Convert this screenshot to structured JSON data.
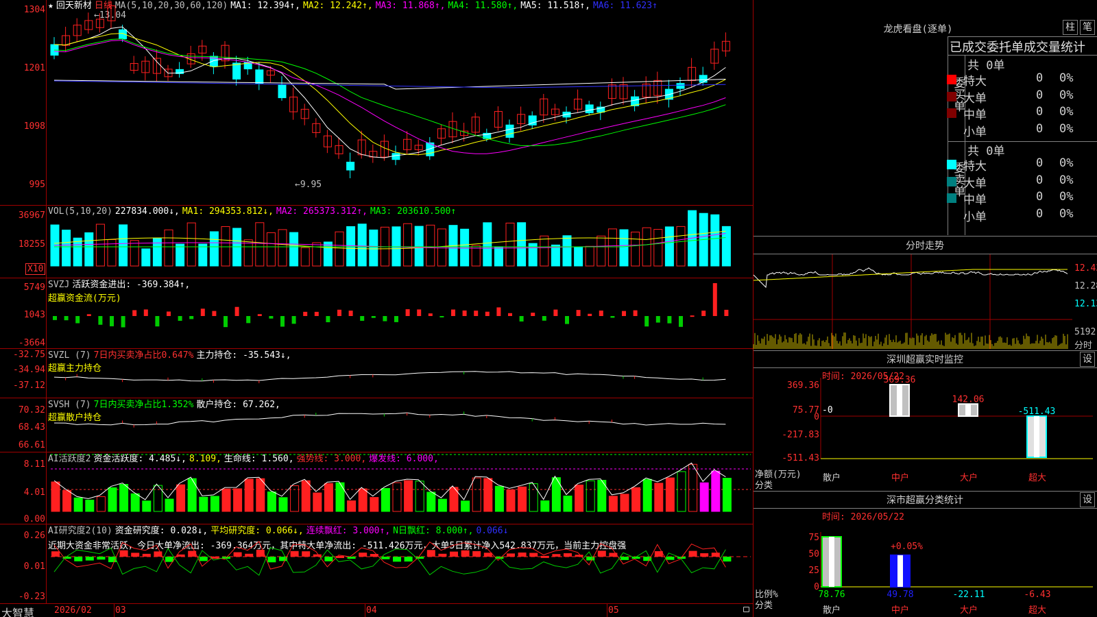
{
  "colors": {
    "up": "#ff2020",
    "down": "#00ffff",
    "ma1": "#ffffff",
    "ma2": "#ffff00",
    "ma3": "#ff00ff",
    "ma4": "#00ff00",
    "ma5": "#ffffff",
    "ma6": "#3030ff",
    "grid": "#a00000"
  },
  "kpanel": {
    "star": "★",
    "stock": "回天新材",
    "period": "日线",
    "items": [
      {
        "t": "MA(5,10,20,30,60,120)",
        "c": "#c0c0c0"
      },
      {
        "t": "MA1: 12.394↑,",
        "c": "#ffffff"
      },
      {
        "t": "MA2: 12.242↑,",
        "c": "#ffff00"
      },
      {
        "t": "MA3: 11.868↑,",
        "c": "#ff00ff"
      },
      {
        "t": "MA4: 11.580↑,",
        "c": "#00ff00"
      },
      {
        "t": "MA5: 11.518↑,",
        "c": "#ffffff"
      },
      {
        "t": "MA6: 11.623↑",
        "c": "#3030ff"
      }
    ],
    "ticks": [
      "1304",
      "1201",
      "1098",
      "995"
    ],
    "high_label": "←13.04",
    "low_label": "←9.95"
  },
  "vol": {
    "items": [
      {
        "t": "VOL(5,10,20)",
        "c": "#c0c0c0"
      },
      {
        "t": "227834.000↓,",
        "c": "#ffffff"
      },
      {
        "t": "MA1: 294353.812↓,",
        "c": "#ffff00"
      },
      {
        "t": "MA2: 265373.312↑,",
        "c": "#ff00ff"
      },
      {
        "t": "MA3: 203610.500↑",
        "c": "#00ff00"
      }
    ],
    "ticks": [
      "36967",
      "18255"
    ],
    "unit": "X10"
  },
  "svzj": {
    "items": [
      {
        "t": "SVZJ",
        "c": "#c0c0c0"
      },
      {
        "t": "活跃资金进出: -369.384↑,",
        "c": "#ffffff"
      }
    ],
    "subtitle": "超赢资金流(万元)",
    "ticks": [
      "5749",
      "1043",
      "-3664"
    ]
  },
  "svzl": {
    "items": [
      {
        "t": "SVZL (7)",
        "c": "#c0c0c0"
      },
      {
        "t": "7日内买卖净占比0.647%",
        "c": "#ff3030"
      },
      {
        "t": "主力持仓: -35.543↓,",
        "c": "#ffffff"
      }
    ],
    "subtitle": "超赢主力持仓",
    "ticks": [
      "-32.75",
      "-34.94",
      "-37.12"
    ]
  },
  "svsh": {
    "items": [
      {
        "t": "SVSH (7)",
        "c": "#c0c0c0"
      },
      {
        "t": "7日内买卖净占比1.352%",
        "c": "#00ff00"
      },
      {
        "t": "散户持仓: 67.262,",
        "c": "#ffffff"
      }
    ],
    "subtitle": "超赢散户持仓",
    "ticks": [
      "70.32",
      "68.43",
      "66.61"
    ]
  },
  "ai1": {
    "items": [
      {
        "t": "AI活跃度2",
        "c": "#c0c0c0"
      },
      {
        "t": "资金活跃度: 4.485↓,",
        "c": "#ffffff"
      },
      {
        "t": "8.109,",
        "c": "#ffff00"
      },
      {
        "t": "生命线: 1.560,",
        "c": "#ffffff"
      },
      {
        "t": "强势线: 3.000,",
        "c": "#ff3030"
      },
      {
        "t": "爆发线: 6.000,",
        "c": "#ff00ff"
      }
    ],
    "ticks": [
      "8.11",
      "4.01",
      "0.00"
    ]
  },
  "ai2": {
    "items": [
      {
        "t": "AI研究度2(10)",
        "c": "#c0c0c0"
      },
      {
        "t": "资金研究度: 0.028↓,",
        "c": "#ffffff"
      },
      {
        "t": "平均研究度: 0.066↓,",
        "c": "#ffff00"
      },
      {
        "t": "连续飘红: 3.000↑,",
        "c": "#ff00ff"
      },
      {
        "t": "N日飘红: 8.000↑,",
        "c": "#00ff00"
      },
      {
        "t": "0.066↓",
        "c": "#3030ff"
      }
    ],
    "comment": "近期大资金非常活跃，今日大单净流出: -369.364万元，其中特大单净流出: -511.426万元，大单5日累计净入542.837万元，当前主力控盘强",
    "ticks": [
      "0.26",
      "0.01",
      "-0.23"
    ]
  },
  "timeline": {
    "brand": "大智慧",
    "labels": [
      "2026/02",
      "03",
      "04",
      "05"
    ]
  },
  "lhb": {
    "title": "龙虎看盘(逐单)",
    "btn1": "柱",
    "btn2": "笔",
    "tabs": "已成交委托单成交量统计",
    "buy_group": "委买单",
    "sell_group": "委卖单",
    "buy_total": "共 0单",
    "sell_total": "共 0单",
    "rows": [
      "特大",
      "大单",
      "中单",
      "小单"
    ],
    "buy_colors": [
      "#ff0000",
      "#800000",
      "#800000",
      ""
    ],
    "sell_colors": [
      "#00ffff",
      "#008080",
      "#008080",
      ""
    ],
    "count": "0",
    "pct": "0%"
  },
  "fenshi": {
    "title": "分时走势",
    "ticks": [
      "12.43",
      "12.28",
      "12.13"
    ],
    "vol_tick": "5192",
    "vol_unit": "分时"
  },
  "monitor": {
    "title": "深圳超赢实时监控",
    "btn": "设",
    "date": "时间: 2026/05/22",
    "ticks": [
      "369.36",
      "75.77",
      "0",
      "-217.83",
      "-511.43"
    ],
    "zero_label": "-0",
    "values": [
      "369.36",
      "142.06",
      "-511.43"
    ],
    "ylabel": "净额(万元)",
    "xlabel": "分类",
    "cats": [
      "散户",
      "中户",
      "大户",
      "超大"
    ]
  },
  "classify": {
    "title": "深市超赢分类统计",
    "btn": "设",
    "date": "时间: 2026/05/22",
    "ticks": [
      "75",
      "50",
      "25",
      "0"
    ],
    "top_label": "+0.05%",
    "values": [
      "78.76",
      "49.78",
      "-22.11",
      "-6.43"
    ],
    "ylabel": "比例%",
    "xlabel": "分类",
    "cats": [
      "散户",
      "中户",
      "大户",
      "超大"
    ]
  }
}
